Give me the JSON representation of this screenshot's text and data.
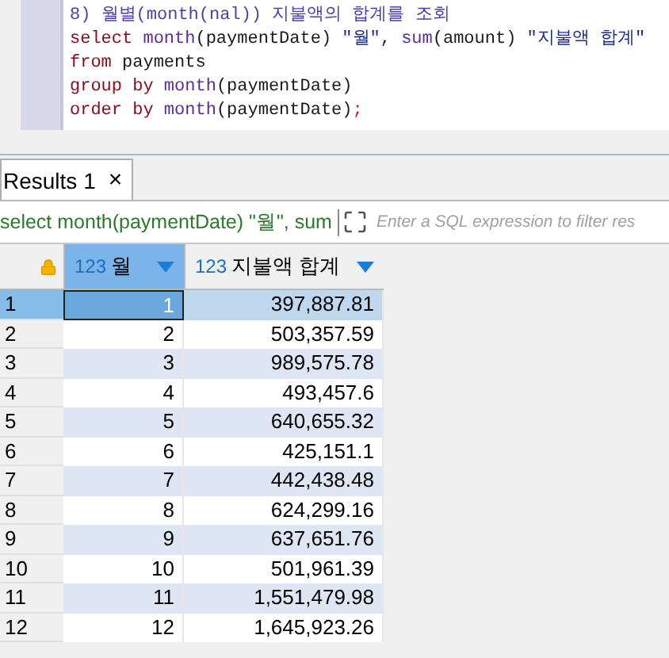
{
  "editor": {
    "lines": [
      [
        {
          "kind": "comment",
          "text": "8) 월별(month(nal)) 지불액의 합계를 조회"
        }
      ],
      [
        {
          "kind": "keyword",
          "text": "select "
        },
        {
          "kind": "function",
          "text": "month"
        },
        {
          "kind": "text",
          "text": "(paymentDate) "
        },
        {
          "kind": "string",
          "text": "\"월\""
        },
        {
          "kind": "text",
          "text": ", "
        },
        {
          "kind": "function",
          "text": "sum"
        },
        {
          "kind": "text",
          "text": "(amount) "
        },
        {
          "kind": "string",
          "text": "\"지불액 합계\""
        }
      ],
      [
        {
          "kind": "keyword",
          "text": "from "
        },
        {
          "kind": "text",
          "text": "payments"
        }
      ],
      [
        {
          "kind": "keyword",
          "text": "group by "
        },
        {
          "kind": "function",
          "text": "month"
        },
        {
          "kind": "text",
          "text": "(paymentDate)"
        }
      ],
      [
        {
          "kind": "keyword",
          "text": "order by "
        },
        {
          "kind": "function",
          "text": "month"
        },
        {
          "kind": "text",
          "text": "(paymentDate)"
        },
        {
          "kind": "punct",
          "text": ";"
        }
      ]
    ]
  },
  "tabs": [
    {
      "label": "Results 1",
      "close": "×",
      "selected": true
    }
  ],
  "filter": {
    "query": "select month(paymentDate) \"월\", sum",
    "placeholder": "Enter a SQL expression to filter res"
  },
  "table": {
    "columns": [
      {
        "type": "123",
        "label": "월",
        "selected": true
      },
      {
        "type": "123",
        "label": "지불액 합계",
        "selected": false
      }
    ],
    "rows": [
      {
        "num": "1",
        "month": "1",
        "total": "397,887.81",
        "selected": true
      },
      {
        "num": "2",
        "month": "2",
        "total": "503,357.59",
        "selected": false
      },
      {
        "num": "3",
        "month": "3",
        "total": "989,575.78",
        "selected": false
      },
      {
        "num": "4",
        "month": "4",
        "total": "493,457.6",
        "selected": false
      },
      {
        "num": "5",
        "month": "5",
        "total": "640,655.32",
        "selected": false
      },
      {
        "num": "6",
        "month": "6",
        "total": "425,151.1",
        "selected": false
      },
      {
        "num": "7",
        "month": "7",
        "total": "442,438.48",
        "selected": false
      },
      {
        "num": "8",
        "month": "8",
        "total": "624,299.16",
        "selected": false
      },
      {
        "num": "9",
        "month": "9",
        "total": "637,651.76",
        "selected": false
      },
      {
        "num": "10",
        "month": "10",
        "total": "501,961.39",
        "selected": false
      },
      {
        "num": "11",
        "month": "11",
        "total": "1,551,479.98",
        "selected": false
      },
      {
        "num": "12",
        "month": "12",
        "total": "1,645,923.26",
        "selected": false
      }
    ]
  }
}
